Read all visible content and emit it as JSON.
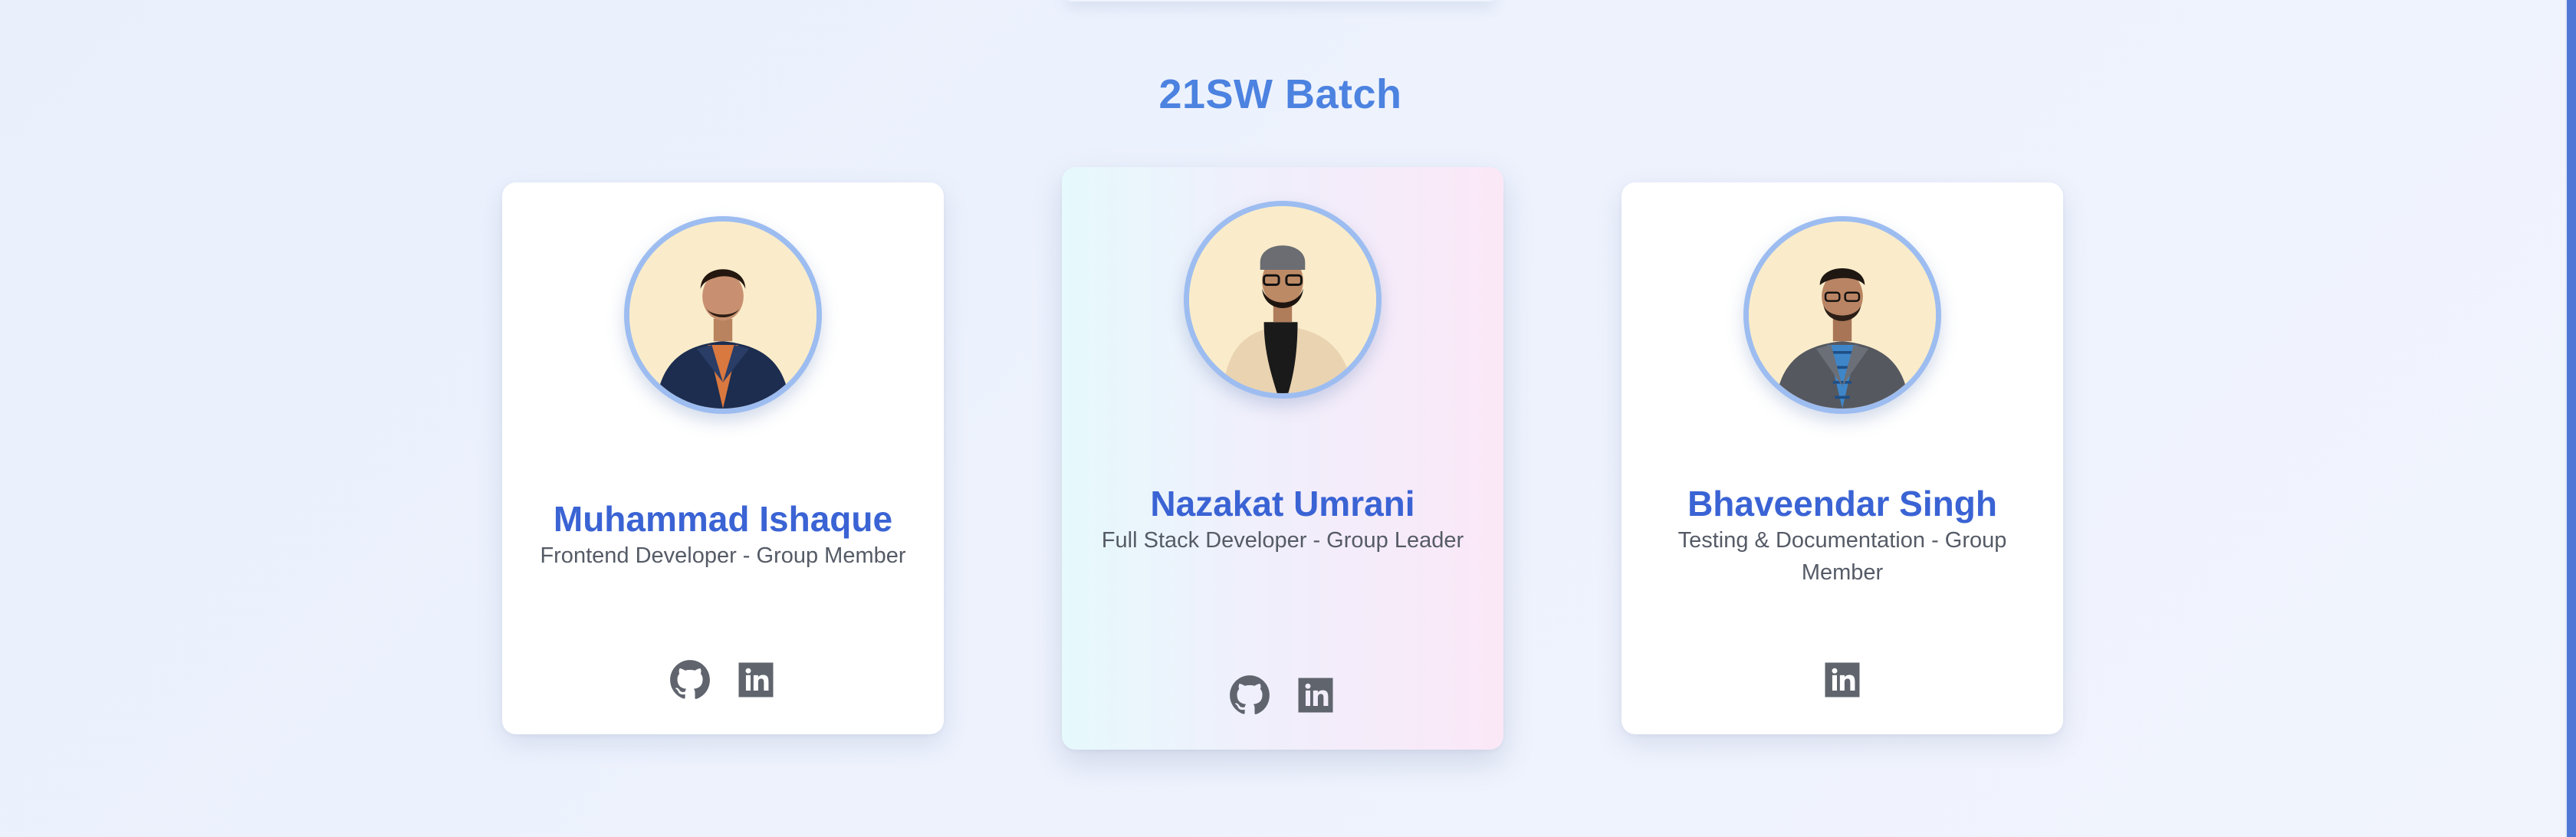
{
  "section": {
    "title": "21SW Batch"
  },
  "members": [
    {
      "name": "Muhammad Ishaque",
      "role": "Frontend Developer - Group Member",
      "links": [
        "github-icon",
        "linkedin-icon"
      ]
    },
    {
      "name": "Nazakat Umrani",
      "role": "Full Stack Developer - Group Leader",
      "links": [
        "github-icon",
        "linkedin-icon"
      ]
    },
    {
      "name": "Bhaveendar Singh",
      "role": "Testing & Documentation - Group Member",
      "links": [
        "linkedin-icon"
      ]
    }
  ],
  "colors": {
    "title": "#4c82e0",
    "name": "#3a63d4",
    "role": "#555b66",
    "avatar_border": "#9dbdf1",
    "avatar_bg": "#faecca",
    "icon": "#5f646d",
    "scrollbar_thumb": "#4f78d6"
  }
}
